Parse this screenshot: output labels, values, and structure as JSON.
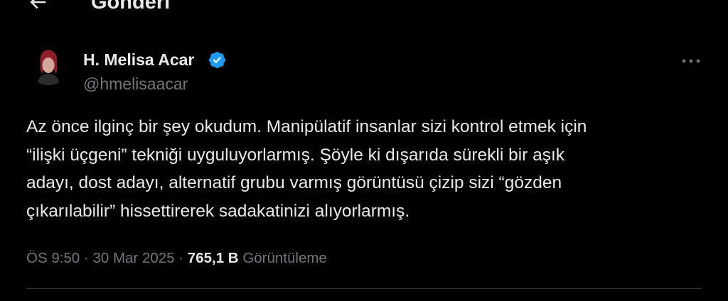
{
  "header": {
    "title": "Gönderi",
    "back_icon": "arrow-left-icon"
  },
  "author": {
    "name": "H. Melisa Acar",
    "handle": "@hmelisaacar",
    "verified_icon": "verified-badge-icon",
    "verified_color": "#1d9bf0"
  },
  "more_icon": "more-horizontal-icon",
  "tweet": {
    "lines": [
      "Az önce ilginç bir şey okudum. Manipülatif insanlar sizi kontrol etmek için",
      "“ilişki üçgeni” tekniği uyguluyorlarmış. Şöyle ki dışarıda sürekli bir aşık",
      "adayı, dost adayı, alternatif grubu varmış görüntüsü çizip sizi “gözden",
      "çıkarılabilir” hissettirerek sadakatinizi alıyorlarmış."
    ]
  },
  "meta": {
    "time": "ÖS 9:50",
    "separator": "·",
    "date": "30 Mar 2025",
    "views_count": "765,1 B",
    "views_label": "Görüntüleme"
  },
  "colors": {
    "background": "#000000",
    "text_primary": "#e7e9ea",
    "text_secondary": "#71767b",
    "divider": "#2f3336"
  }
}
